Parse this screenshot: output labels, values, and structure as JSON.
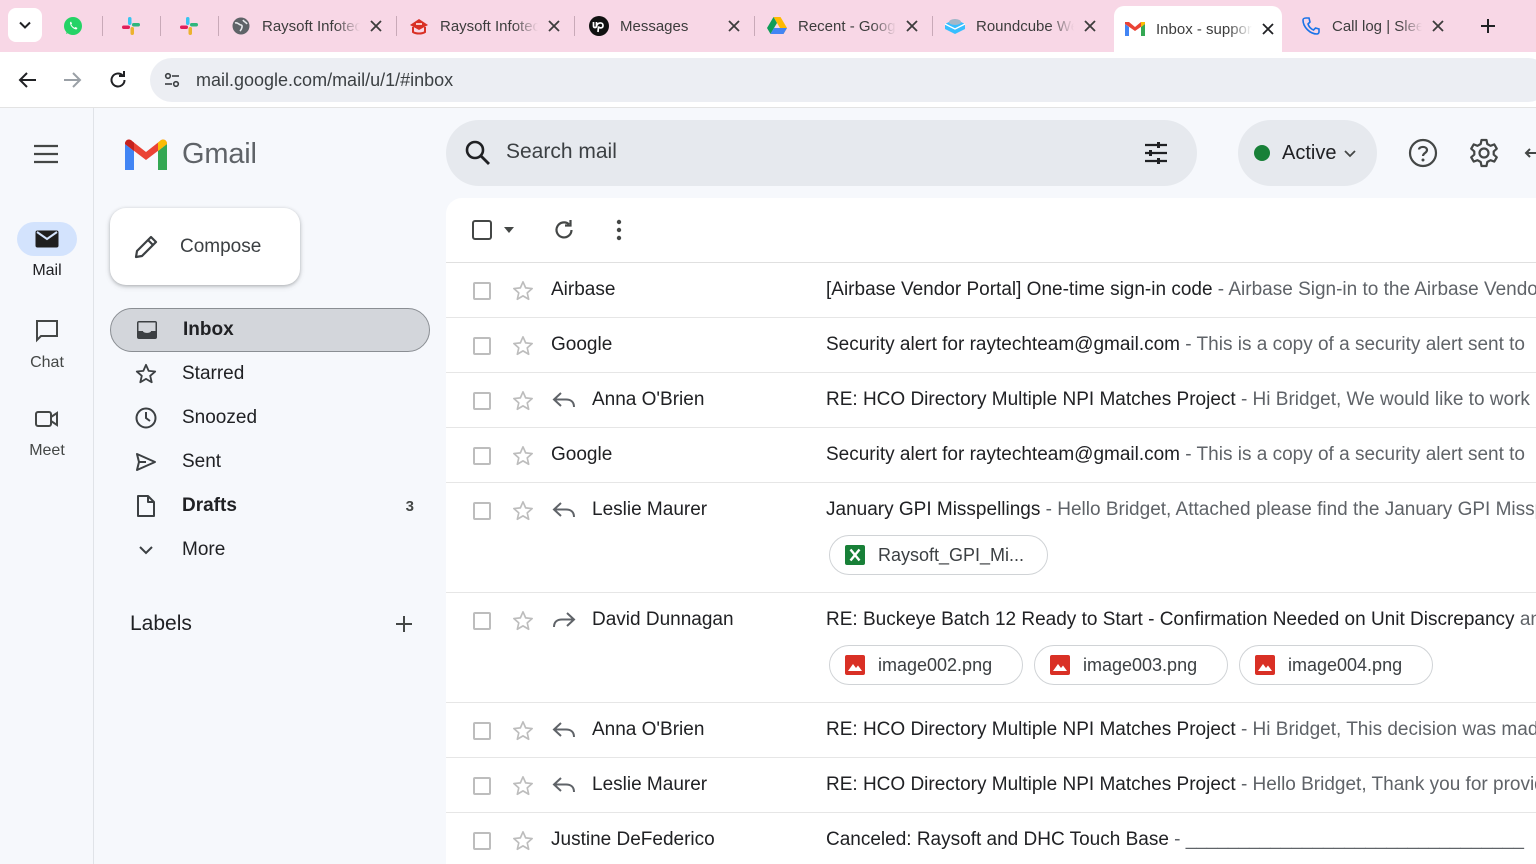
{
  "browser": {
    "tabs": [
      {
        "title": "",
        "icon": "whatsapp-icon"
      },
      {
        "title": "",
        "icon": "slack-icon"
      },
      {
        "title": "",
        "icon": "slack-icon"
      },
      {
        "title": "Raysoft Infotech",
        "icon": "globe-icon"
      },
      {
        "title": "Raysoft Infotech",
        "icon": "raysoft-logo-icon"
      },
      {
        "title": "Messages",
        "icon": "upwork-icon"
      },
      {
        "title": "Recent - Google Drive",
        "icon": "google-drive-icon"
      },
      {
        "title": "Roundcube Webmail",
        "icon": "roundcube-icon"
      },
      {
        "title": "Inbox - support",
        "icon": "gmail-icon"
      },
      {
        "title": "Call log | Sleek",
        "icon": "phone-icon"
      }
    ],
    "url": "mail.google.com/mail/u/1/#inbox"
  },
  "rail": {
    "items": [
      {
        "label": "Mail"
      },
      {
        "label": "Chat"
      },
      {
        "label": "Meet"
      }
    ]
  },
  "sidebar": {
    "logo_text": "Gmail",
    "compose_label": "Compose",
    "nav": [
      {
        "label": "Inbox",
        "count": ""
      },
      {
        "label": "Starred",
        "count": ""
      },
      {
        "label": "Snoozed",
        "count": ""
      },
      {
        "label": "Sent",
        "count": ""
      },
      {
        "label": "Drafts",
        "count": "3"
      },
      {
        "label": "More",
        "count": ""
      }
    ],
    "labels_heading": "Labels"
  },
  "header": {
    "search_placeholder": "Search mail",
    "status_label": "Active",
    "status_color": "#188038"
  },
  "emails": [
    {
      "from": "Airbase",
      "subject": "[Airbase Vendor Portal] One-time sign-in code",
      "snippet": " - Airbase Sign-in to the Airbase Vendor Portal",
      "icon": "",
      "attachments": []
    },
    {
      "from": "Google",
      "subject": "Security alert for raytechteam@gmail.com",
      "snippet": " - This is a copy of a security alert sent to",
      "icon": "",
      "attachments": []
    },
    {
      "from": "Anna O'Brien",
      "subject": "RE: HCO Directory Multiple NPI Matches Project",
      "snippet": " - Hi Bridget, We would like to work on",
      "icon": "reply-icon",
      "attachments": []
    },
    {
      "from": "Google",
      "subject": "Security alert for raytechteam@gmail.com",
      "snippet": " - This is a copy of a security alert sent to",
      "icon": "",
      "attachments": []
    },
    {
      "from": "Leslie Maurer",
      "subject": "January GPI Misspellings",
      "snippet": " - Hello Bridget, Attached please find the January GPI Misspellings",
      "icon": "reply-icon",
      "attachments": [
        {
          "name": "Raysoft_GPI_Mi...",
          "type": "excel"
        }
      ]
    },
    {
      "from": "David Dunnagan",
      "subject": "RE: Buckeye Batch 12 Ready to Start - Confirmation Needed on Unit Discrepancy",
      "snippet": " and",
      "icon": "forward-icon",
      "attachments": [
        {
          "name": "image002.png",
          "type": "image"
        },
        {
          "name": "image003.png",
          "type": "image"
        },
        {
          "name": "image004.png",
          "type": "image"
        }
      ]
    },
    {
      "from": "Anna O'Brien",
      "subject": "RE: HCO Directory Multiple NPI Matches Project",
      "snippet": " - Hi Bridget, This decision was made",
      "icon": "reply-icon",
      "attachments": []
    },
    {
      "from": "Leslie Maurer",
      "subject": "RE: HCO Directory Multiple NPI Matches Project",
      "snippet": " - Hello Bridget, Thank you for providing",
      "icon": "reply-icon",
      "attachments": []
    },
    {
      "from": "Justine DeFederico",
      "subject": "Canceled: Raysoft and DHC Touch Base",
      "snippet": " - ________________________________",
      "icon": "",
      "attachments": []
    }
  ]
}
